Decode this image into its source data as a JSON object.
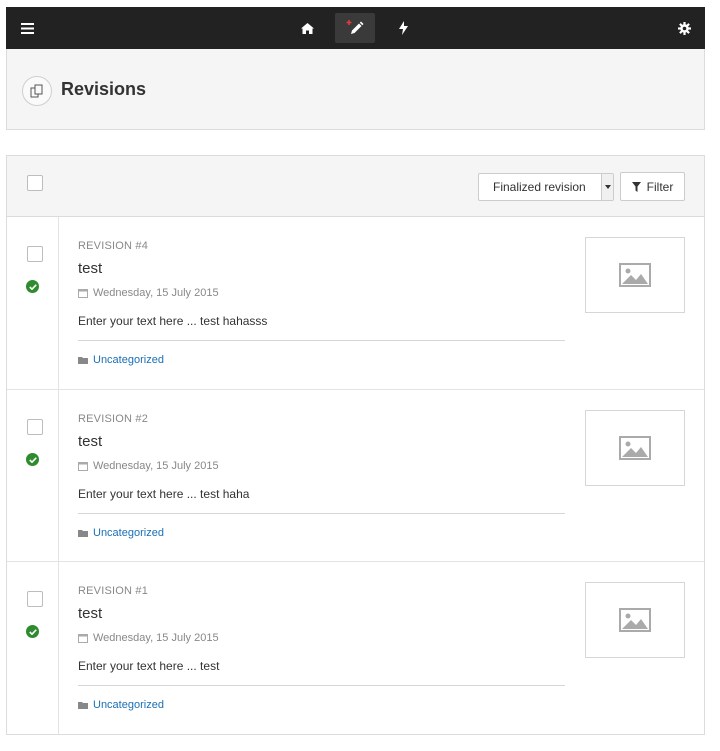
{
  "topbar": {
    "icons": [
      "menu-icon",
      "home-icon",
      "compose-icon",
      "bolt-icon",
      "gear-icon"
    ],
    "active": "compose-icon",
    "accent": "#e23b3b"
  },
  "header": {
    "title": "Revisions",
    "icon": "revisions-icon"
  },
  "toolbar": {
    "status_select": {
      "selected": "Finalized revision"
    },
    "filter_label": "Filter"
  },
  "revisions": [
    {
      "label": "REVISION #4",
      "title": "test",
      "date": "Wednesday, 15 July 2015",
      "excerpt": "Enter your text here ... test hahasss",
      "category": "Uncategorized",
      "status": "approved"
    },
    {
      "label": "REVISION #2",
      "title": "test",
      "date": "Wednesday, 15 July 2015",
      "excerpt": "Enter your text here ... test haha",
      "category": "Uncategorized",
      "status": "approved"
    },
    {
      "label": "REVISION #1",
      "title": "test",
      "date": "Wednesday, 15 July 2015",
      "excerpt": "Enter your text here ... test",
      "category": "Uncategorized",
      "status": "approved"
    }
  ],
  "colors": {
    "topbar_bg": "#222222",
    "link": "#1a6fb5",
    "status_ok": "#2e8b2e"
  }
}
